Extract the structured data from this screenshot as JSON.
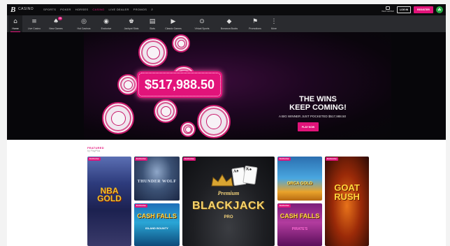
{
  "brand": {
    "logo_mark": "B",
    "logo_word": "CASINO"
  },
  "top_nav": {
    "links": [
      "SPORTS",
      "POKER",
      "HORSES",
      "CASINO",
      "LIVE DEALER",
      "PROMOS"
    ],
    "active": "CASINO",
    "help_label": "HELP CENTER",
    "login_label": "LOG IN",
    "register_label": "REGISTER"
  },
  "categories": [
    {
      "label": "Home",
      "icon": "home-icon",
      "active": true
    },
    {
      "label": "Live Casino",
      "icon": "live-casino-icon"
    },
    {
      "label": "New Games",
      "icon": "new-games-icon",
      "badge": "10"
    },
    {
      "label": "Hot Casinos",
      "icon": "hot-icon"
    },
    {
      "label": "Exclusive",
      "icon": "exclusive-icon"
    },
    {
      "label": "Jackpot Slots",
      "icon": "jackpot-icon"
    },
    {
      "label": "Slots",
      "icon": "slots-icon"
    },
    {
      "label": "Classic Games",
      "icon": "play-icon"
    },
    {
      "label": "Virtual Sports",
      "icon": "virtual-sports-icon"
    },
    {
      "label": "Bonanza Bucks",
      "icon": "diamond-icon"
    },
    {
      "label": "Promotions",
      "icon": "megaphone-icon"
    },
    {
      "label": "More",
      "icon": "more-icon"
    }
  ],
  "hero": {
    "amount": "$517,988.50",
    "title_line1": "THE WINS",
    "title_line2": "KEEP COMING!",
    "subtitle": "A BIG WINNER JUST POCKETED $517,988.50",
    "cta": "PLAY NOW",
    "slides": 5,
    "active_slide": 0
  },
  "featured": {
    "title": "FEATURED",
    "subtitle": "by PlayPlus",
    "tag": "Exclusive",
    "games": {
      "nba": "NBA GOLD",
      "wolf": "THUNDER WOLF",
      "cash1": "CASH FALLS",
      "cash1_sub": "ISLAND BOUNTY",
      "bj_premium": "Premium",
      "bj": "BLACKJACK",
      "bj_pro": "PRO",
      "orca": "ORCA GOLD",
      "cash2": "CASH FALLS",
      "cash2_sub": "PIRATE'S",
      "goat": "GOAT RUSH"
    }
  },
  "colors": {
    "accent": "#e2137a",
    "nav_bg": "#2a2b2f",
    "topbar_bg": "#0b0b0d"
  }
}
